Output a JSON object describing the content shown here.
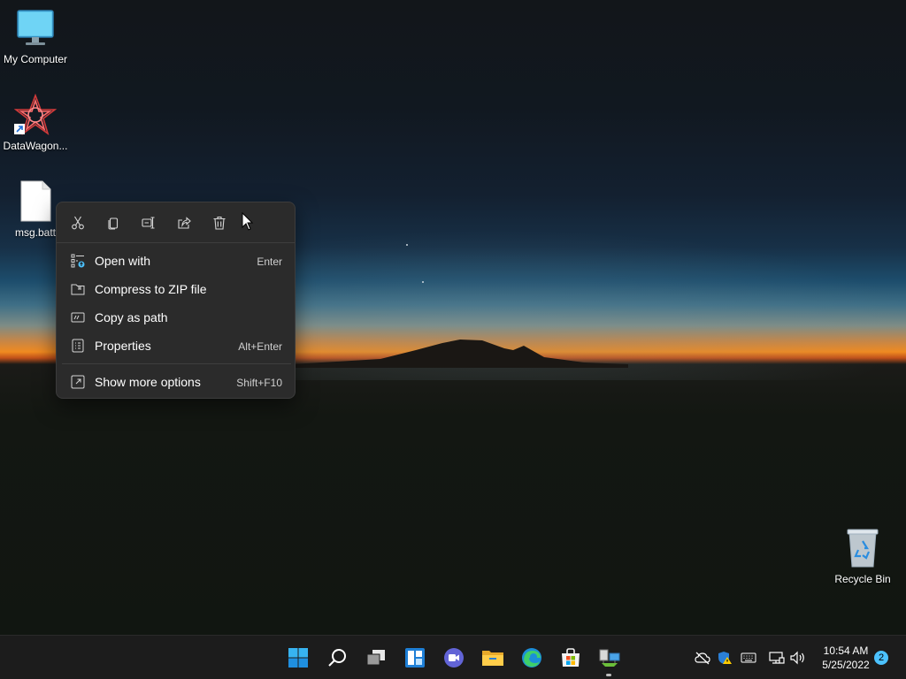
{
  "desktop": {
    "icons": [
      {
        "label": "My Computer",
        "icon": "monitor-icon"
      },
      {
        "label": "DataWagon...",
        "icon": "datawagon-app-icon"
      },
      {
        "label": "msg.batt",
        "icon": "file-icon"
      },
      {
        "label": "Recycle Bin",
        "icon": "recycle-bin-icon"
      }
    ]
  },
  "context_menu": {
    "toolbar": [
      {
        "name": "cut",
        "icon": "scissors-icon"
      },
      {
        "name": "copy",
        "icon": "copy-icon"
      },
      {
        "name": "rename",
        "icon": "rename-icon"
      },
      {
        "name": "share",
        "icon": "share-icon"
      },
      {
        "name": "delete",
        "icon": "trash-icon"
      }
    ],
    "items": [
      {
        "label": "Open with",
        "shortcut": "Enter",
        "icon": "open-with-icon"
      },
      {
        "label": "Compress to ZIP file",
        "shortcut": "",
        "icon": "zip-folder-icon"
      },
      {
        "label": "Copy as path",
        "shortcut": "",
        "icon": "copy-path-icon"
      },
      {
        "label": "Properties",
        "shortcut": "Alt+Enter",
        "icon": "properties-icon"
      },
      {
        "label": "Show more options",
        "shortcut": "Shift+F10",
        "icon": "show-more-icon"
      }
    ]
  },
  "taskbar": {
    "apps": [
      {
        "name": "Start",
        "icon": "windows-start-icon"
      },
      {
        "name": "Search",
        "icon": "search-icon"
      },
      {
        "name": "Task View",
        "icon": "task-view-icon"
      },
      {
        "name": "Widgets",
        "icon": "widgets-icon"
      },
      {
        "name": "Chat",
        "icon": "chat-icon"
      },
      {
        "name": "File Explorer",
        "icon": "folder-icon"
      },
      {
        "name": "Microsoft Edge",
        "icon": "edge-icon"
      },
      {
        "name": "Microsoft Store",
        "icon": "store-icon"
      },
      {
        "name": "Network App",
        "icon": "network-app-icon"
      }
    ],
    "tray": {
      "icons": [
        "cloud-off-icon",
        "security-warning-icon",
        "keyboard-icon",
        "network-icon",
        "volume-icon"
      ],
      "time": "10:54 AM",
      "date": "5/25/2022",
      "notification_count": "2"
    }
  },
  "colors": {
    "menu_bg": "#2b2b2b",
    "taskbar_bg": "#1c1c1c",
    "accent": "#4cc2ff",
    "sunset_orange": "#f08a20"
  }
}
